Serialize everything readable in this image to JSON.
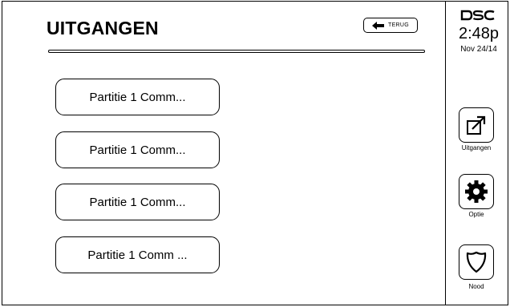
{
  "header": {
    "title": "UITGANGEN",
    "back_label": "TERUG"
  },
  "outputs": [
    {
      "label": "Partitie 1 Comm..."
    },
    {
      "label": "Partitie 1 Comm..."
    },
    {
      "label": "Partitie 1 Comm..."
    },
    {
      "label": "Partitie 1 Comm ..."
    }
  ],
  "sidebar": {
    "brand": "DSC",
    "time": "2:48p",
    "date": "Nov 24/14",
    "buttons": [
      {
        "label": "Uitgangen",
        "icon": "external-link-icon"
      },
      {
        "label": "Optie",
        "icon": "gear-icon"
      },
      {
        "label": "Nood",
        "icon": "shield-icon"
      }
    ]
  }
}
